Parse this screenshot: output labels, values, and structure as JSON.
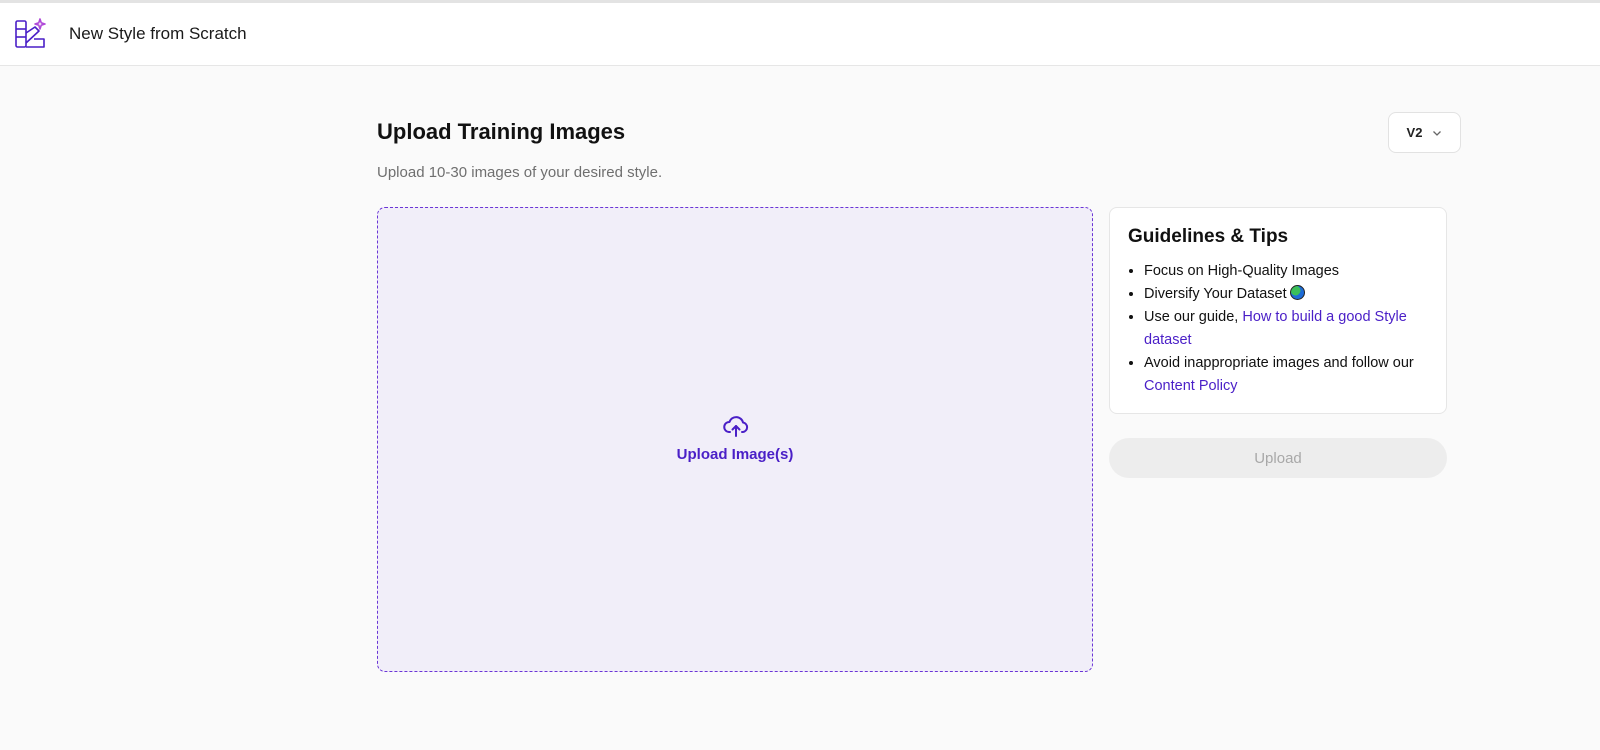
{
  "header": {
    "logo_icon": "brush-sparkle-icon",
    "title": "New Style from Scratch"
  },
  "main": {
    "title": "Upload Training Images",
    "subtitle": "Upload 10-30 images of your desired style.",
    "version_select": {
      "value": "V2",
      "icon": "chevron-down-icon"
    },
    "dropzone": {
      "icon": "cloud-upload-icon",
      "label": "Upload Image(s)"
    },
    "upload_button": "Upload"
  },
  "tips": {
    "title": "Guidelines & Tips",
    "items": [
      {
        "text": "Focus on High-Quality Images"
      },
      {
        "text": "Diversify Your Dataset",
        "icon": "globe-icon"
      },
      {
        "text": "Use our guide, ",
        "link": "How to build a good Style dataset"
      },
      {
        "text": "Avoid inappropriate images and follow our ",
        "link": "Content Policy"
      }
    ]
  },
  "colors": {
    "accent": "#4a1fc7",
    "dropzone_bg": "#f1eef9",
    "dropzone_border": "#6b35d6",
    "page_bg": "#fafafa"
  }
}
